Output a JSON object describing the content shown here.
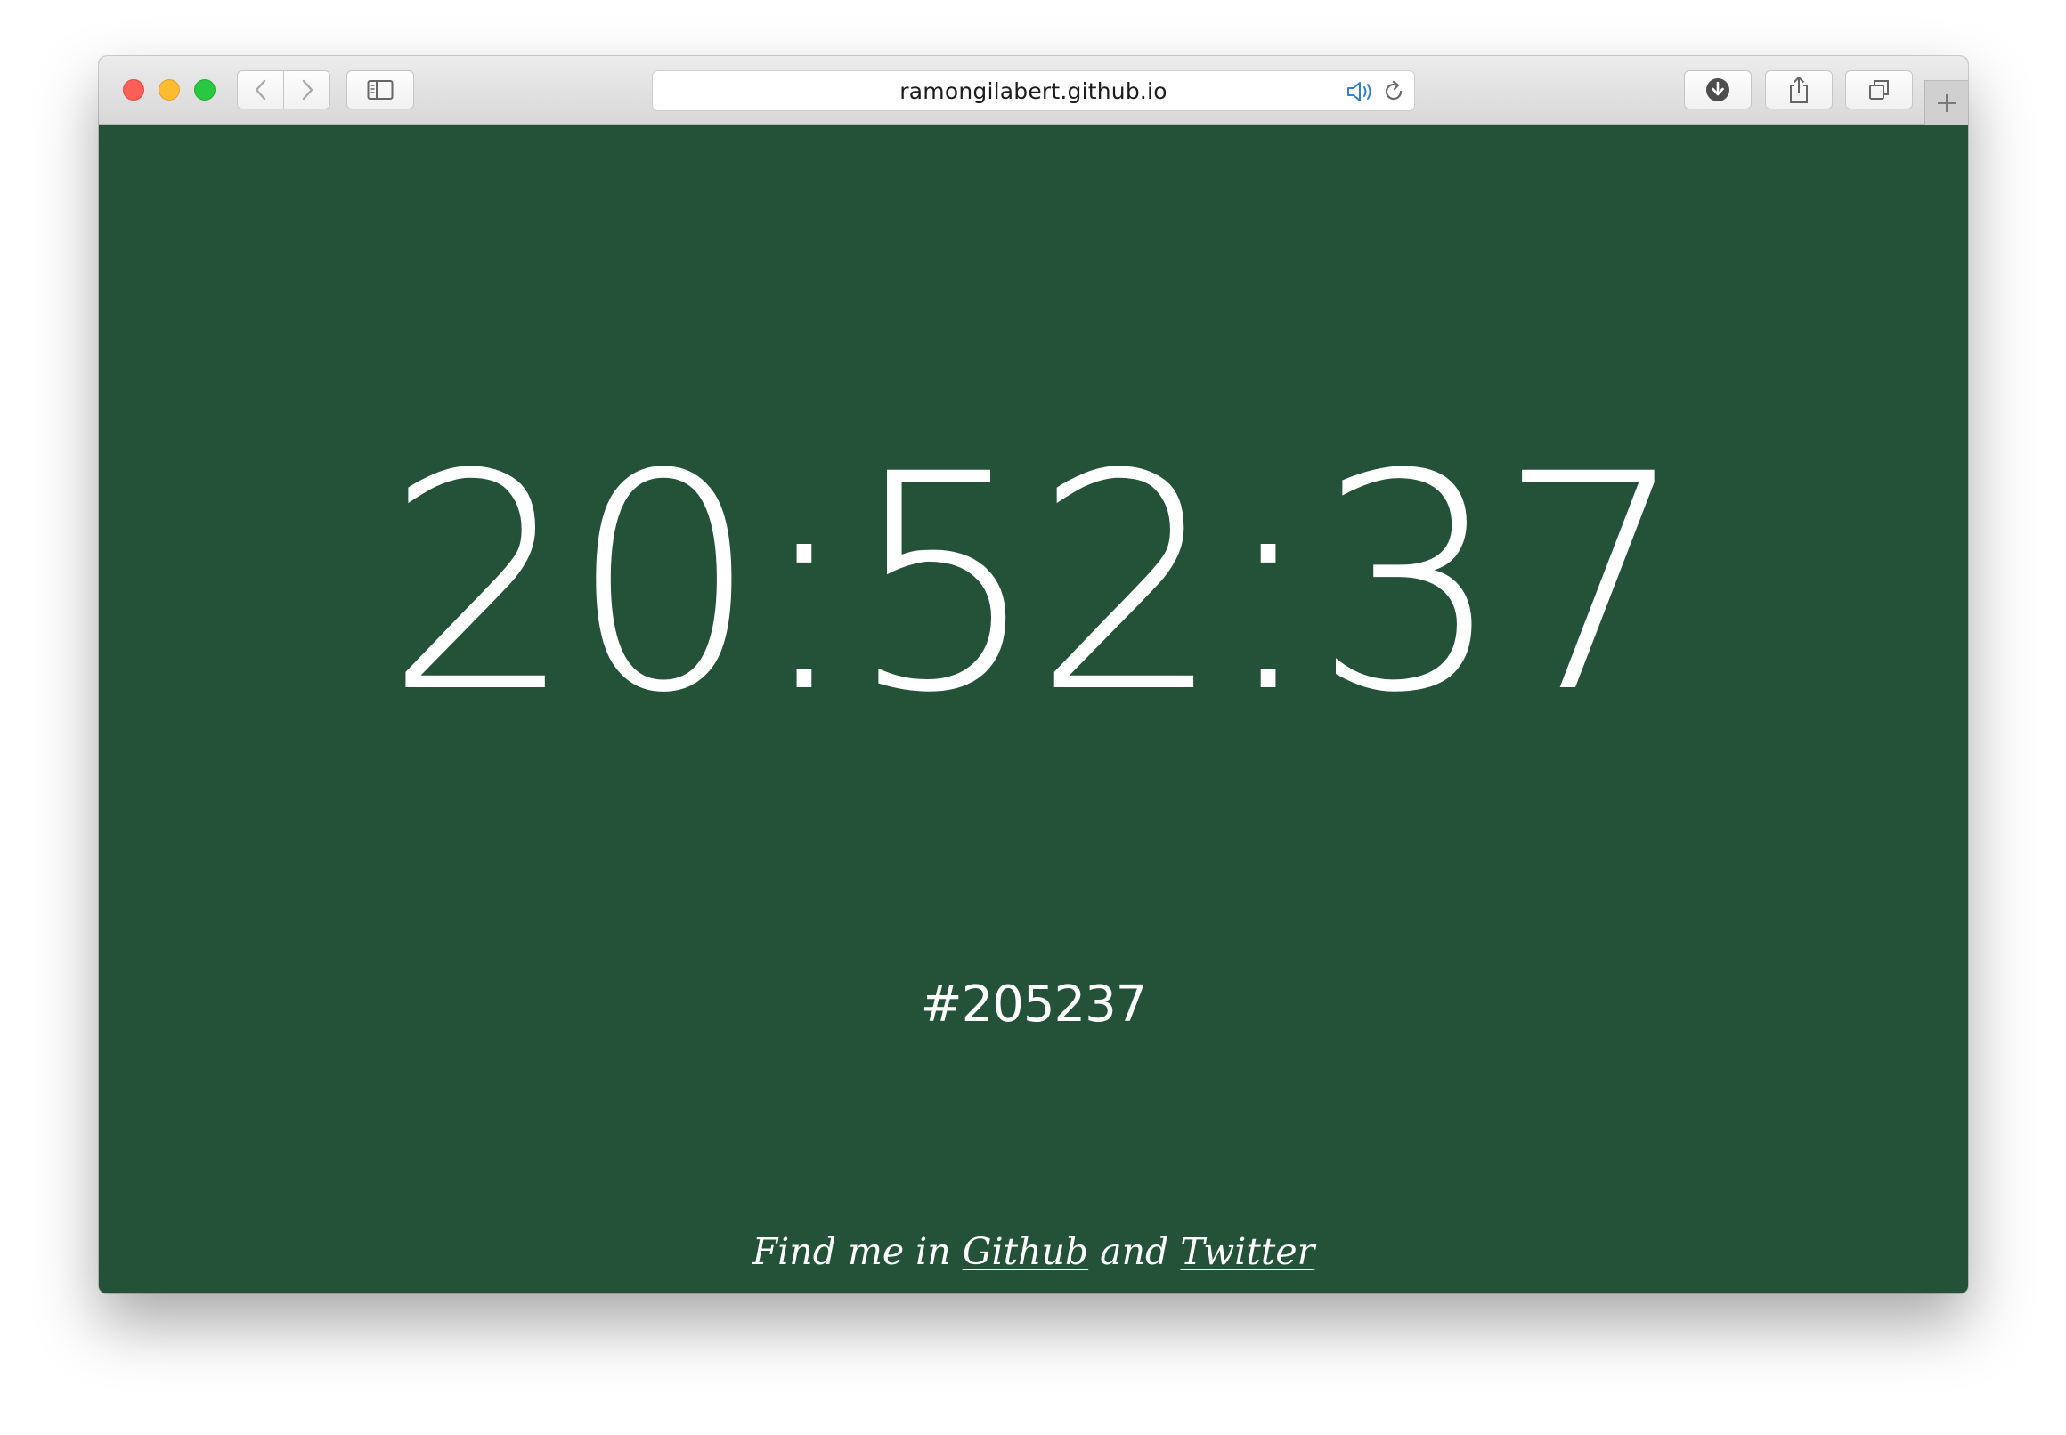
{
  "browser": {
    "url": "ramongilabert.github.io",
    "icons": {
      "back": "chevron-left-icon",
      "forward": "chevron-right-icon",
      "sidebar": "sidebar-icon",
      "speaker": "speaker-icon",
      "reload": "reload-icon",
      "download": "download-icon",
      "share": "share-icon",
      "tabs": "tabs-icon",
      "new_tab": "plus-icon"
    }
  },
  "page": {
    "time": "20:52:37",
    "hex": "#205237",
    "background_color": "#235238",
    "footer": {
      "prefix": "Find me in",
      "github": "Github",
      "conj": "and",
      "twitter": "Twitter"
    }
  }
}
